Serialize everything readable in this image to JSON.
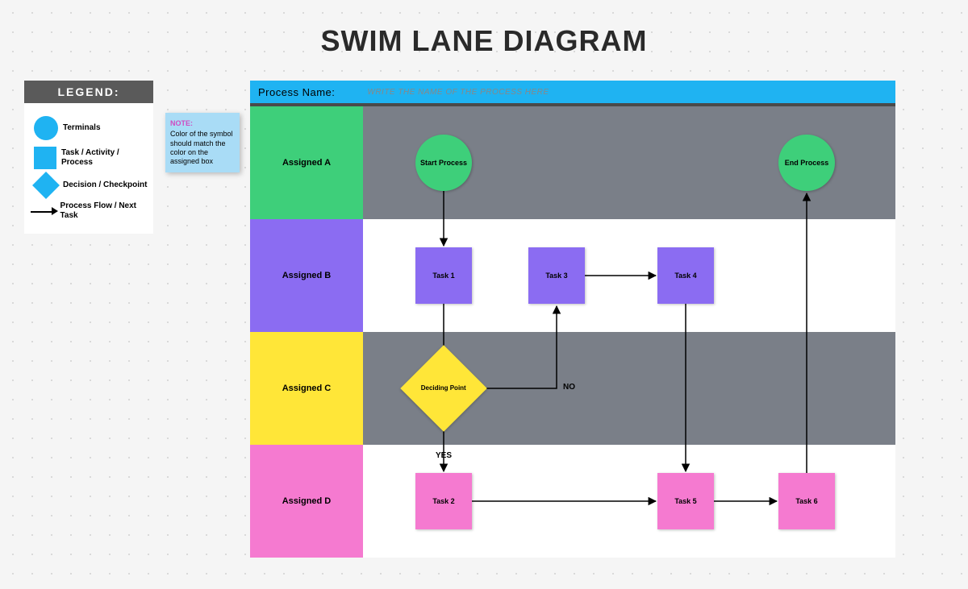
{
  "title": "SWIM LANE DIAGRAM",
  "legend": {
    "header": "LEGEND:",
    "terminals": "Terminals",
    "task": "Task / Activity / Process",
    "decision": "Decision / Checkpoint",
    "flow": "Process Flow / Next Task"
  },
  "note": {
    "header": "NOTE:",
    "body": "Color of the symbol should match the color on the assigned box"
  },
  "process_name_label": "Process Name:",
  "process_name_placeholder": "WRITE THE NAME OF THE PROCESS HERE",
  "lanes": {
    "a": "Assigned A",
    "b": "Assigned B",
    "c": "Assigned C",
    "d": "Assigned D"
  },
  "nodes": {
    "start": "Start Process",
    "end": "End Process",
    "task1": "Task 1",
    "task3": "Task 3",
    "task4": "Task 4",
    "deciding": "Deciding Point",
    "task2": "Task 2",
    "task5": "Task 5",
    "task6": "Task 6"
  },
  "edges": {
    "yes": "YES",
    "no": "NO"
  },
  "colors": {
    "laneA": "#3ecf7a",
    "laneB": "#8b6cf2",
    "laneC": "#ffe638",
    "laneD": "#f57ad0",
    "header": "#1fb3f2",
    "greyLane": "#7a7f88"
  }
}
